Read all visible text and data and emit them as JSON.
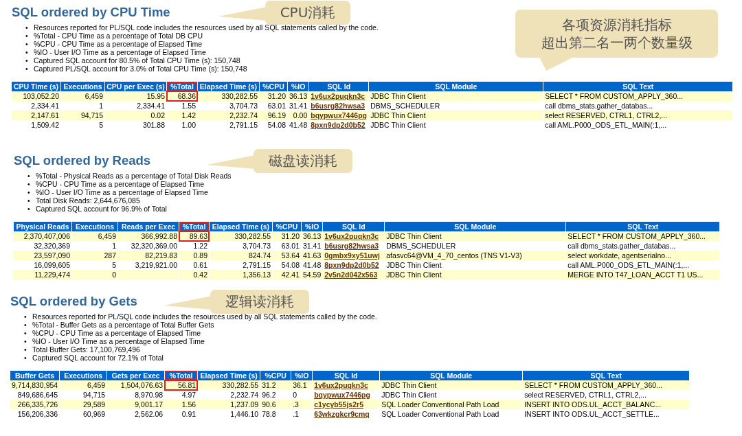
{
  "note": {
    "lines": [
      "各项资源消耗指标",
      "超出第二名一两个数量级"
    ]
  },
  "sections": [
    {
      "title": "SQL ordered by CPU Time",
      "callout": "CPU消耗",
      "marker": "•",
      "bullets": [
        "Resources reported for PL/SQL code includes the resources used by all SQL statements called by the code.",
        "%Total - CPU Time as a percentage of Total DB CPU",
        "%CPU - CPU Time as a percentage of Elapsed Time",
        "%IO - User I/O Time as a percentage of Elapsed Time",
        "Captured SQL account for 80.5% of Total CPU Time (s): 150,748",
        "Captured PL/SQL account for 3.0% of Total CPU Time (s): 150,748"
      ],
      "columns": [
        {
          "label": "CPU Time (s)",
          "kind": "number",
          "highlighted": false
        },
        {
          "label": "Executions",
          "kind": "number",
          "highlighted": false
        },
        {
          "label": "CPU per Exec (s)",
          "kind": "number",
          "highlighted": false
        },
        {
          "label": "%Total",
          "kind": "number",
          "highlighted": true
        },
        {
          "label": "Elapsed Time (s)",
          "kind": "number",
          "highlighted": false
        },
        {
          "label": "%CPU",
          "kind": "number",
          "highlighted": false
        },
        {
          "label": "%IO",
          "kind": "number",
          "highlighted": false
        },
        {
          "label": "SQL Id",
          "kind": "link",
          "highlighted": false
        },
        {
          "label": "SQL Module",
          "kind": "text",
          "highlighted": false
        },
        {
          "label": "SQL Text",
          "kind": "text",
          "highlighted": false
        }
      ],
      "rows": [
        [
          "103,052.20",
          "6,459",
          "15.95",
          "68.36",
          "330,282.55",
          "31.20",
          "36.13",
          "1v6ux2puqkn3c",
          "JDBC Thin Client",
          "SELECT * FROM CUSTOM_APPLY_360..."
        ],
        [
          "2,334.41",
          "1",
          "2,334.41",
          "1.55",
          "3,704.73",
          "63.01",
          "31.41",
          "b6usrg82hwsa3",
          "DBMS_SCHEDULER",
          "call dbms_stats.gather_databas..."
        ],
        [
          "2,147.61",
          "94,715",
          "0.02",
          "1.42",
          "2,232.74",
          "96.19",
          "0.00",
          "bqypwux7446pg",
          "JDBC Thin Client",
          "select RESERVED, CTRL1, CTRL2,..."
        ],
        [
          "1,509.42",
          "5",
          "301.88",
          "1.00",
          "2,791.15",
          "54.08",
          "41.48",
          "8pxn9dp2d0b52",
          "JDBC Thin Client",
          "call AML.P000_ODS_ETL_MAIN(:1,..."
        ]
      ]
    },
    {
      "title": "SQL ordered by Reads",
      "callout": "磁盘读消耗",
      "marker": "•",
      "bullets": [
        "%Total - Physical Reads as a percentage of Total Disk Reads",
        "%CPU - CPU Time as a percentage of Elapsed Time",
        "%IO - User I/O Time as a percentage of Elapsed Time",
        "Total Disk Reads: 2,644,676,085",
        "Captured SQL account for 96.9% of Total"
      ],
      "columns": [
        {
          "label": "Physical Reads",
          "kind": "number",
          "highlighted": false
        },
        {
          "label": "Executions",
          "kind": "number",
          "highlighted": false
        },
        {
          "label": "Reads per Exec",
          "kind": "number",
          "highlighted": false
        },
        {
          "label": "%Total",
          "kind": "number",
          "highlighted": true
        },
        {
          "label": "Elapsed Time (s)",
          "kind": "number",
          "highlighted": false
        },
        {
          "label": "%CPU",
          "kind": "number",
          "highlighted": false
        },
        {
          "label": "%IO",
          "kind": "number",
          "highlighted": false
        },
        {
          "label": "SQL Id",
          "kind": "link",
          "highlighted": false
        },
        {
          "label": "SQL Module",
          "kind": "text",
          "highlighted": false
        },
        {
          "label": "SQL Text",
          "kind": "text",
          "highlighted": false
        }
      ],
      "rows": [
        [
          "2,370,407,006",
          "6,459",
          "366,992.88",
          "89.63",
          "330,282.55",
          "31.20",
          "36.13",
          "1v6ux2puqkn3c",
          "JDBC Thin Client",
          "SELECT * FROM CUSTOM_APPLY_360..."
        ],
        [
          "32,320,369",
          "1",
          "32,320,369.00",
          "1.22",
          "3,704.73",
          "63.01",
          "31.41",
          "b6usrg82hwsa3",
          "DBMS_SCHEDULER",
          "call dbms_stats.gather_databas..."
        ],
        [
          "23,597,090",
          "287",
          "82,219.83",
          "0.89",
          "824.74",
          "53.64",
          "41.63",
          "0gmbx9xy51uwj",
          "afasvc64@VM_4_70_centos (TNS V1-V3)",
          "select workdate, agentserialno..."
        ],
        [
          "16,099,605",
          "5",
          "3,219,921.00",
          "0.61",
          "2,791.15",
          "54.08",
          "41.48",
          "8pxn9dp2d0b52",
          "JDBC Thin Client",
          "call AML.P000_ODS_ETL_MAIN(:1,..."
        ],
        [
          "11,229,474",
          "0",
          null,
          "0.42",
          "1,356.13",
          "42.41",
          "54.59",
          "2v5n2d042x563",
          "JDBC Thin Client",
          "MERGE INTO T47_LOAN_ACCT T1 US..."
        ]
      ]
    },
    {
      "title": "SQL ordered by Gets",
      "callout": "逻辑读消耗",
      "marker": "•",
      "bullets": [
        "Resources reported for PL/SQL code includes the resources used by all SQL statements called by the code.",
        "%Total - Buffer Gets as a percentage of Total Buffer Gets",
        "%CPU - CPU Time as a percentage of Elapsed Time",
        "%IO - User I/O Time as a percentage of Elapsed Time",
        "Total Buffer Gets: 17,100,769,496",
        "Captured SQL account for 72.1% of Total"
      ],
      "columns": [
        {
          "label": "Buffer Gets",
          "kind": "number",
          "highlighted": false
        },
        {
          "label": "Executions",
          "kind": "number",
          "highlighted": false
        },
        {
          "label": "Gets per Exec",
          "kind": "number",
          "highlighted": false
        },
        {
          "label": "%Total",
          "kind": "number",
          "highlighted": true
        },
        {
          "label": "Elapsed Time (s)",
          "kind": "number",
          "highlighted": false
        },
        {
          "label": "%CPU",
          "kind": "text",
          "highlighted": false
        },
        {
          "label": "%IO",
          "kind": "text",
          "highlighted": false
        },
        {
          "label": "SQL Id",
          "kind": "link",
          "highlighted": false
        },
        {
          "label": "SQL Module",
          "kind": "text",
          "highlighted": false
        },
        {
          "label": "SQL Text",
          "kind": "text",
          "highlighted": false
        }
      ],
      "rows": [
        [
          "9,714,830,954",
          "6,459",
          "1,504,076.63",
          "56.81",
          "330,282.55",
          "31.2",
          "36.1",
          "1v6ux2puqkn3c",
          "JDBC Thin Client",
          "SELECT * FROM CUSTOM_APPLY_360..."
        ],
        [
          "849,686,645",
          "94,715",
          "8,970.98",
          "4.97",
          "2,232.74",
          "96.2",
          "0",
          "bqypwux7446pg",
          "JDBC Thin Client",
          "select RESERVED, CTRL1, CTRL2,..."
        ],
        [
          "266,335,726",
          "29,589",
          "9,001.17",
          "1.56",
          "1,237.09",
          "90.6",
          ".3",
          "c1ycyb55js2r5",
          "SQL Loader Conventional Path Load",
          "INSERT INTO ODS.UL_ACCT_BALANC..."
        ],
        [
          "156,206,336",
          "60,969",
          "2,562.06",
          "0.91",
          "1,446.10",
          "78.8",
          ".1",
          "63wkzgkcr9cmq",
          "SQL Loader Conventional Path Load",
          "INSERT INTO ODS.UL_ACCT_SETTLE..."
        ]
      ]
    }
  ]
}
